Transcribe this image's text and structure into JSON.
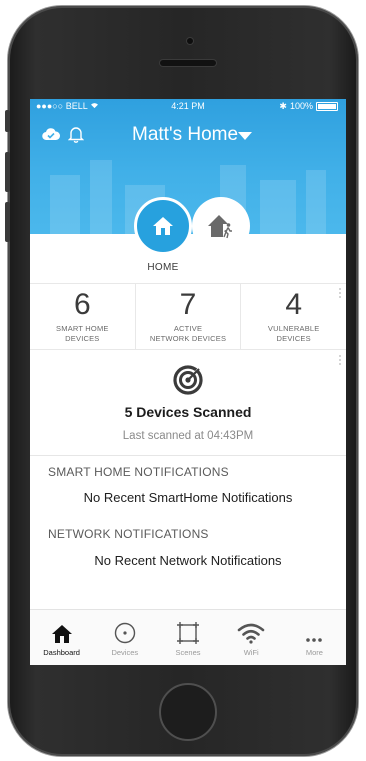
{
  "status_bar": {
    "carrier": "BELL",
    "time": "4:21 PM",
    "battery": "100%"
  },
  "header": {
    "home_name": "Matt's Home"
  },
  "mode_tabs": {
    "active_label": "HOME"
  },
  "stats": [
    {
      "value": "6",
      "label_line1": "SMART HOME",
      "label_line2": "DEVICES"
    },
    {
      "value": "7",
      "label_line1": "ACTIVE",
      "label_line2": "NETWORK DEVICES"
    },
    {
      "value": "4",
      "label_line1": "VULNERABLE",
      "label_line2": "DEVICES"
    }
  ],
  "scan": {
    "title": "5 Devices Scanned",
    "subtitle": "Last scanned at 04:43PM"
  },
  "smart_home_notifications": {
    "title": "SMART HOME NOTIFICATIONS",
    "message": "No Recent SmartHome Notifications"
  },
  "network_notifications": {
    "title": "NETWORK NOTIFICATIONS",
    "message": "No Recent Network Notifications"
  },
  "tabbar": [
    {
      "label": "Dashboard",
      "icon": "home-icon",
      "active": true
    },
    {
      "label": "Devices",
      "icon": "devices-icon",
      "active": false
    },
    {
      "label": "Scenes",
      "icon": "scenes-icon",
      "active": false
    },
    {
      "label": "WiFi",
      "icon": "wifi-icon",
      "active": false
    },
    {
      "label": "More",
      "icon": "more-icon",
      "active": false
    }
  ],
  "colors": {
    "accent": "#27a1de",
    "header_bg": "#41b0e8"
  }
}
